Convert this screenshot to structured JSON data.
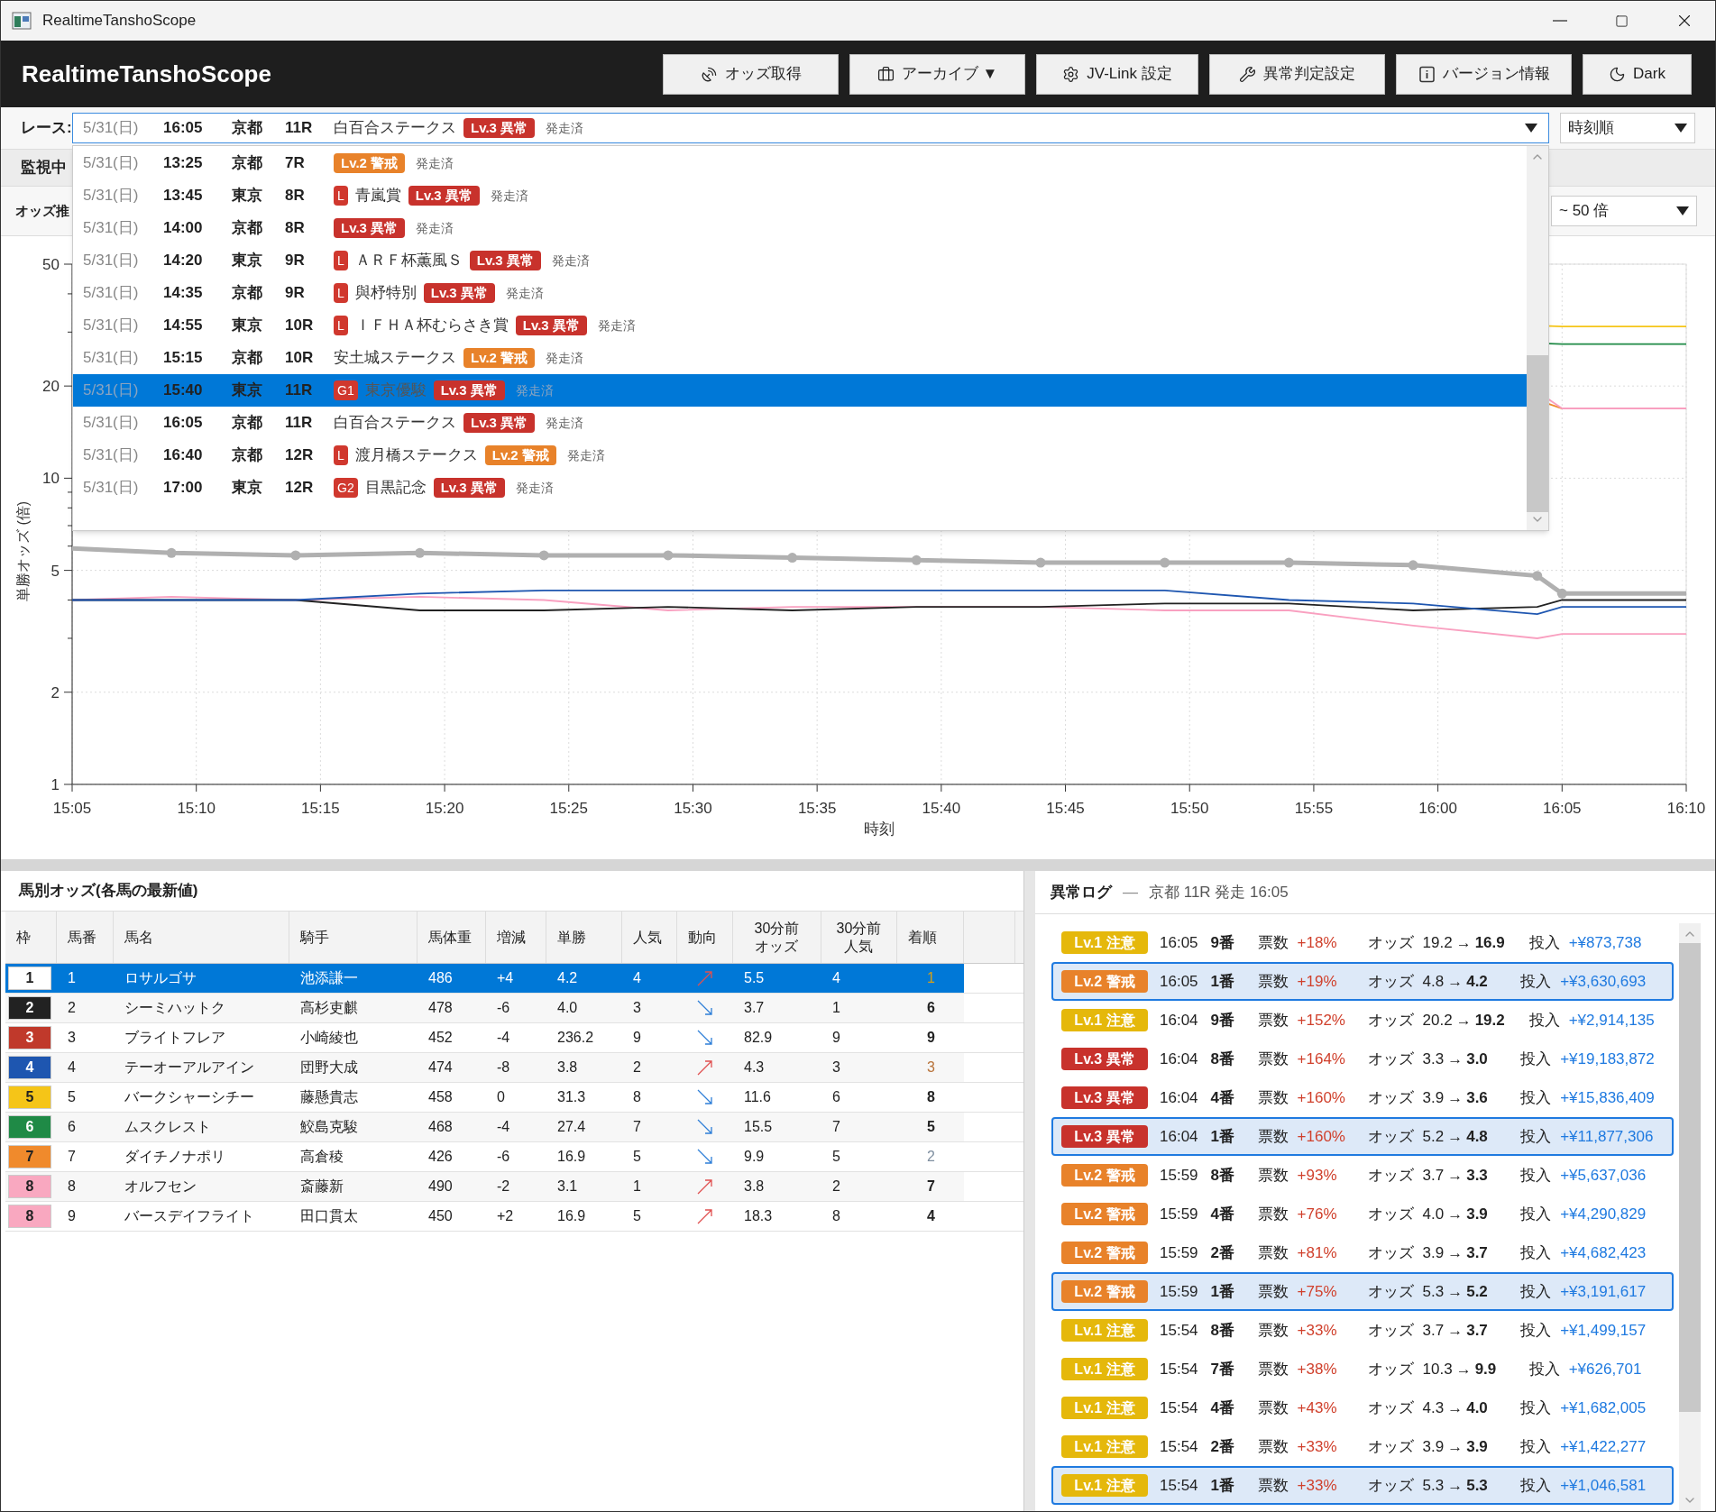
{
  "window": {
    "title": "RealtimeTanshoScope"
  },
  "header": {
    "app_name": "RealtimeTanshoScope",
    "buttons": [
      "オッズ取得",
      "アーカイブ ▼",
      "JV-Link 設定",
      "異常判定設定",
      "バージョン情報",
      "Dark"
    ]
  },
  "race_selector": {
    "label": "レース:",
    "value": {
      "date": "5/31(日)",
      "time": "16:05",
      "venue": "京都",
      "race": "11R",
      "name": "白百合ステークス",
      "level": {
        "kind": "lv3",
        "text": "Lv.3 異常"
      },
      "status": "発走済"
    },
    "sort": "時刻順",
    "options": [
      {
        "date": "5/31(日)",
        "time": "13:25",
        "venue": "京都",
        "race": "7R",
        "level": {
          "kind": "lv2",
          "text": "Lv.2 警戒"
        },
        "status": "発走済",
        "selected": false
      },
      {
        "date": "5/31(日)",
        "time": "13:45",
        "venue": "東京",
        "race": "8R",
        "grade": "L",
        "name": "青嵐賞",
        "level": {
          "kind": "lv3",
          "text": "Lv.3 異常"
        },
        "status": "発走済",
        "selected": false
      },
      {
        "date": "5/31(日)",
        "time": "14:00",
        "venue": "京都",
        "race": "8R",
        "level": {
          "kind": "lv3",
          "text": "Lv.3 異常"
        },
        "status": "発走済",
        "selected": false
      },
      {
        "date": "5/31(日)",
        "time": "14:20",
        "venue": "東京",
        "race": "9R",
        "grade": "L",
        "name": "ＡＲＦ杯薫風Ｓ",
        "level": {
          "kind": "lv3",
          "text": "Lv.3 異常"
        },
        "status": "発走済",
        "selected": false
      },
      {
        "date": "5/31(日)",
        "time": "14:35",
        "venue": "京都",
        "race": "9R",
        "grade": "L",
        "name": "與杼特別",
        "level": {
          "kind": "lv3",
          "text": "Lv.3 異常"
        },
        "status": "発走済",
        "selected": false
      },
      {
        "date": "5/31(日)",
        "time": "14:55",
        "venue": "東京",
        "race": "10R",
        "grade": "L",
        "name": "ＩＦＨＡ杯むらさき賞",
        "level": {
          "kind": "lv3",
          "text": "Lv.3 異常"
        },
        "status": "発走済",
        "selected": false
      },
      {
        "date": "5/31(日)",
        "time": "15:15",
        "venue": "京都",
        "race": "10R",
        "name": "安土城ステークス",
        "level": {
          "kind": "lv2",
          "text": "Lv.2 警戒"
        },
        "status": "発走済",
        "selected": false
      },
      {
        "date": "5/31(日)",
        "time": "15:40",
        "venue": "東京",
        "race": "11R",
        "grade": "G1",
        "name": "東京優駿",
        "level": {
          "kind": "lv3",
          "text": "Lv.3 異常"
        },
        "status": "発走済",
        "selected": true
      },
      {
        "date": "5/31(日)",
        "time": "16:05",
        "venue": "京都",
        "race": "11R",
        "name": "白百合ステークス",
        "level": {
          "kind": "lv3",
          "text": "Lv.3 異常"
        },
        "status": "発走済",
        "selected": false
      },
      {
        "date": "5/31(日)",
        "time": "16:40",
        "venue": "京都",
        "race": "12R",
        "grade": "L",
        "name": "渡月橋ステークス",
        "level": {
          "kind": "lv2",
          "text": "Lv.2 警戒"
        },
        "status": "発走済",
        "selected": false
      },
      {
        "date": "5/31(日)",
        "time": "17:00",
        "venue": "東京",
        "race": "12R",
        "grade": "G2",
        "name": "目黒記念",
        "level": {
          "kind": "lv3",
          "text": "Lv.3 異常"
        },
        "status": "発走済",
        "selected": false
      }
    ]
  },
  "monitor_row": {
    "label": "監視中"
  },
  "odds_row": {
    "label": "オッズ推",
    "range": "~ 50 倍"
  },
  "chart": {
    "xlabel": "時刻",
    "ylabel": "単勝オッズ (倍)",
    "x_tick_labels": [
      "15:05",
      "15:10",
      "15:15",
      "15:20",
      "15:25",
      "15:30",
      "15:35",
      "15:40",
      "15:45",
      "15:50",
      "15:55",
      "16:00",
      "16:05",
      "16:10"
    ],
    "y_tick_labels": [
      "50",
      "20",
      "10",
      "5",
      "2",
      "1"
    ],
    "lines": [
      {
        "color": "#f5c518",
        "selected": false
      },
      {
        "color": "#1f8a46",
        "selected": false
      },
      {
        "color": "#f08a2c",
        "selected": false
      },
      {
        "color": "#f9a0c0",
        "selected": false
      },
      {
        "color": "#f9a0c0",
        "selected": false
      },
      {
        "color": "#222222",
        "selected": false
      },
      {
        "color": "#1e56b0",
        "selected": false
      },
      {
        "color": "#b0b0b0",
        "selected": true
      }
    ]
  },
  "horse_table": {
    "title": "馬別オッズ(各馬の最新値)",
    "columns": [
      "枠",
      "馬番",
      "馬名",
      "騎手",
      "馬体重",
      "増減",
      "単勝",
      "人気",
      "動向",
      "30分前オッズ",
      "30分前人気",
      "着順"
    ],
    "rows": [
      {
        "frame": "1",
        "color": "#ffffff",
        "number": "1",
        "name": "ロサルゴサ",
        "jockey": "池添謙一",
        "weight": "486",
        "change": "+4",
        "odds": "4.2",
        "popularity": "4",
        "trend": {
          "kind": "up"
        },
        "odds_30": "5.5",
        "popularity_30": "4",
        "finish": {
          "text": "1",
          "color": "#d4a017",
          "bold": false
        },
        "selected": true
      },
      {
        "frame": "2",
        "color": "#222222",
        "number": "2",
        "name": "シーミハットク",
        "jockey": "高杉吏麒",
        "weight": "478",
        "change": "-6",
        "odds": "4.0",
        "popularity": "3",
        "trend": {
          "kind": "down"
        },
        "odds_30": "3.7",
        "popularity_30": "1",
        "finish": {
          "text": "6",
          "color": "#222222",
          "bold": true
        },
        "selected": false
      },
      {
        "frame": "3",
        "color": "#c0392b",
        "number": "3",
        "name": "ブライトフレア",
        "jockey": "小崎綾也",
        "weight": "452",
        "change": "-4",
        "odds": "236.2",
        "popularity": "9",
        "trend": {
          "kind": "down"
        },
        "odds_30": "82.9",
        "popularity_30": "9",
        "finish": {
          "text": "9",
          "color": "#222222",
          "bold": true
        },
        "selected": false
      },
      {
        "frame": "4",
        "color": "#1e56b0",
        "number": "4",
        "name": "テーオーアルアイン",
        "jockey": "団野大成",
        "weight": "474",
        "change": "-8",
        "odds": "3.8",
        "popularity": "2",
        "trend": {
          "kind": "up"
        },
        "odds_30": "4.3",
        "popularity_30": "3",
        "finish": {
          "text": "3",
          "color": "#b8733a",
          "bold": false
        },
        "selected": false
      },
      {
        "frame": "5",
        "color": "#f5c518",
        "number": "5",
        "name": "バークシャーシチー",
        "jockey": "藤懸貴志",
        "weight": "458",
        "change": "0",
        "odds": "31.3",
        "popularity": "8",
        "trend": {
          "kind": "down"
        },
        "odds_30": "11.6",
        "popularity_30": "6",
        "finish": {
          "text": "8",
          "color": "#222222",
          "bold": true
        },
        "selected": false
      },
      {
        "frame": "6",
        "color": "#1f8a46",
        "number": "6",
        "name": "ムスクレスト",
        "jockey": "鮫島克駿",
        "weight": "468",
        "change": "-4",
        "odds": "27.4",
        "popularity": "7",
        "trend": {
          "kind": "down"
        },
        "odds_30": "15.5",
        "popularity_30": "7",
        "finish": {
          "text": "5",
          "color": "#222222",
          "bold": true
        },
        "selected": false
      },
      {
        "frame": "7",
        "color": "#f08a2c",
        "number": "7",
        "name": "ダイチノナポリ",
        "jockey": "高倉稜",
        "weight": "426",
        "change": "-6",
        "odds": "16.9",
        "popularity": "5",
        "trend": {
          "kind": "down"
        },
        "odds_30": "9.9",
        "popularity_30": "5",
        "finish": {
          "text": "2",
          "color": "#7f8fa0",
          "bold": false
        },
        "selected": false
      },
      {
        "frame": "8",
        "color": "#f9a8c0",
        "number": "8",
        "name": "オルフセン",
        "jockey": "斎藤新",
        "weight": "490",
        "change": "-2",
        "odds": "3.1",
        "popularity": "1",
        "trend": {
          "kind": "up"
        },
        "odds_30": "3.8",
        "popularity_30": "2",
        "finish": {
          "text": "7",
          "color": "#222222",
          "bold": true
        },
        "selected": false
      },
      {
        "frame": "8",
        "color": "#f9a8c0",
        "number": "9",
        "name": "バースデイフライト",
        "jockey": "田口貫太",
        "weight": "450",
        "change": "+2",
        "odds": "16.9",
        "popularity": "5",
        "trend": {
          "kind": "up"
        },
        "odds_30": "18.3",
        "popularity_30": "8",
        "finish": {
          "text": "4",
          "color": "#222222",
          "bold": true
        },
        "selected": false
      }
    ]
  },
  "anomaly_log": {
    "title": "異常ログ",
    "separator": "—",
    "subtitle": "京都 11R 発走 16:05",
    "entries": [
      {
        "kind": "lv1",
        "badge": "Lv.1 注意",
        "time": "16:05",
        "horse": "9番",
        "votes_label": "票数",
        "votes": "+18%",
        "odds_label": "オッズ",
        "odds_from": "19.2",
        "arrow": "→",
        "odds_to": "16.9",
        "bet_label": "投入",
        "bet": "+¥873,738",
        "highlighted": false
      },
      {
        "kind": "lv2",
        "badge": "Lv.2 警戒",
        "time": "16:05",
        "horse": "1番",
        "votes_label": "票数",
        "votes": "+19%",
        "odds_label": "オッズ",
        "odds_from": "4.8",
        "arrow": "→",
        "odds_to": "4.2",
        "bet_label": "投入",
        "bet": "+¥3,630,693",
        "highlighted": true
      },
      {
        "kind": "lv1",
        "badge": "Lv.1 注意",
        "time": "16:04",
        "horse": "9番",
        "votes_label": "票数",
        "votes": "+152%",
        "odds_label": "オッズ",
        "odds_from": "20.2",
        "arrow": "→",
        "odds_to": "19.2",
        "bet_label": "投入",
        "bet": "+¥2,914,135",
        "highlighted": false
      },
      {
        "kind": "lv3",
        "badge": "Lv.3 異常",
        "time": "16:04",
        "horse": "8番",
        "votes_label": "票数",
        "votes": "+164%",
        "odds_label": "オッズ",
        "odds_from": "3.3",
        "arrow": "→",
        "odds_to": "3.0",
        "bet_label": "投入",
        "bet": "+¥19,183,872",
        "highlighted": false
      },
      {
        "kind": "lv3",
        "badge": "Lv.3 異常",
        "time": "16:04",
        "horse": "4番",
        "votes_label": "票数",
        "votes": "+160%",
        "odds_label": "オッズ",
        "odds_from": "3.9",
        "arrow": "→",
        "odds_to": "3.6",
        "bet_label": "投入",
        "bet": "+¥15,836,409",
        "highlighted": false
      },
      {
        "kind": "lv3",
        "badge": "Lv.3 異常",
        "time": "16:04",
        "horse": "1番",
        "votes_label": "票数",
        "votes": "+160%",
        "odds_label": "オッズ",
        "odds_from": "5.2",
        "arrow": "→",
        "odds_to": "4.8",
        "bet_label": "投入",
        "bet": "+¥11,877,306",
        "highlighted": true
      },
      {
        "kind": "lv2",
        "badge": "Lv.2 警戒",
        "time": "15:59",
        "horse": "8番",
        "votes_label": "票数",
        "votes": "+93%",
        "odds_label": "オッズ",
        "odds_from": "3.7",
        "arrow": "→",
        "odds_to": "3.3",
        "bet_label": "投入",
        "bet": "+¥5,637,036",
        "highlighted": false
      },
      {
        "kind": "lv2",
        "badge": "Lv.2 警戒",
        "time": "15:59",
        "horse": "4番",
        "votes_label": "票数",
        "votes": "+76%",
        "odds_label": "オッズ",
        "odds_from": "4.0",
        "arrow": "→",
        "odds_to": "3.9",
        "bet_label": "投入",
        "bet": "+¥4,290,829",
        "highlighted": false
      },
      {
        "kind": "lv2",
        "badge": "Lv.2 警戒",
        "time": "15:59",
        "horse": "2番",
        "votes_label": "票数",
        "votes": "+81%",
        "odds_label": "オッズ",
        "odds_from": "3.9",
        "arrow": "→",
        "odds_to": "3.7",
        "bet_label": "投入",
        "bet": "+¥4,682,423",
        "highlighted": false
      },
      {
        "kind": "lv2",
        "badge": "Lv.2 警戒",
        "time": "15:59",
        "horse": "1番",
        "votes_label": "票数",
        "votes": "+75%",
        "odds_label": "オッズ",
        "odds_from": "5.3",
        "arrow": "→",
        "odds_to": "5.2",
        "bet_label": "投入",
        "bet": "+¥3,191,617",
        "highlighted": true
      },
      {
        "kind": "lv1",
        "badge": "Lv.1 注意",
        "time": "15:54",
        "horse": "8番",
        "votes_label": "票数",
        "votes": "+33%",
        "odds_label": "オッズ",
        "odds_from": "3.7",
        "arrow": "→",
        "odds_to": "3.7",
        "bet_label": "投入",
        "bet": "+¥1,499,157",
        "highlighted": false
      },
      {
        "kind": "lv1",
        "badge": "Lv.1 注意",
        "time": "15:54",
        "horse": "7番",
        "votes_label": "票数",
        "votes": "+38%",
        "odds_label": "オッズ",
        "odds_from": "10.3",
        "arrow": "→",
        "odds_to": "9.9",
        "bet_label": "投入",
        "bet": "+¥626,701",
        "highlighted": false
      },
      {
        "kind": "lv1",
        "badge": "Lv.1 注意",
        "time": "15:54",
        "horse": "4番",
        "votes_label": "票数",
        "votes": "+43%",
        "odds_label": "オッズ",
        "odds_from": "4.3",
        "arrow": "→",
        "odds_to": "4.0",
        "bet_label": "投入",
        "bet": "+¥1,682,005",
        "highlighted": false
      },
      {
        "kind": "lv1",
        "badge": "Lv.1 注意",
        "time": "15:54",
        "horse": "2番",
        "votes_label": "票数",
        "votes": "+33%",
        "odds_label": "オッズ",
        "odds_from": "3.9",
        "arrow": "→",
        "odds_to": "3.9",
        "bet_label": "投入",
        "bet": "+¥1,422,277",
        "highlighted": false
      },
      {
        "kind": "lv1",
        "badge": "Lv.1 注意",
        "time": "15:54",
        "horse": "1番",
        "votes_label": "票数",
        "votes": "+33%",
        "odds_label": "オッズ",
        "odds_from": "5.3",
        "arrow": "→",
        "odds_to": "5.3",
        "bet_label": "投入",
        "bet": "+¥1,046,581",
        "highlighted": true
      }
    ]
  }
}
